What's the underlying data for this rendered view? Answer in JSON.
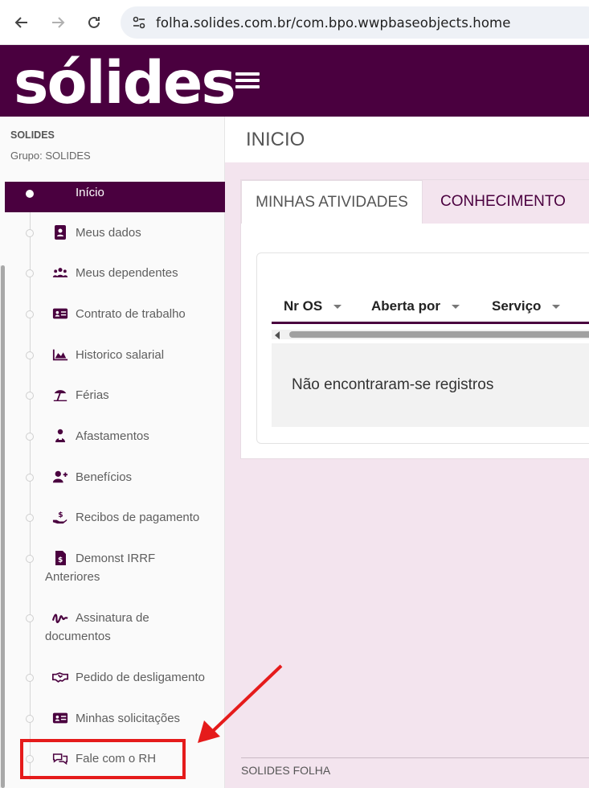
{
  "browser": {
    "url": "folha.solides.com.br/com.bpo.wwpbaseobjects.home"
  },
  "header": {
    "logo_text": "sólides"
  },
  "sidebar": {
    "company": "SOLIDES",
    "group": "Grupo: SOLIDES",
    "items": [
      {
        "label": "Início",
        "icon": "home-icon",
        "active": true
      },
      {
        "label": "Meus dados",
        "icon": "contact-book-icon"
      },
      {
        "label": "Meus dependentes",
        "icon": "people-group-icon"
      },
      {
        "label": "Contrato de trabalho",
        "icon": "id-card-icon"
      },
      {
        "label": "Historico salarial",
        "icon": "area-chart-icon"
      },
      {
        "label": "Férias",
        "icon": "beach-umbrella-icon"
      },
      {
        "label": "Afastamentos",
        "icon": "injured-person-icon"
      },
      {
        "label": "Benefícios",
        "icon": "user-plus-icon"
      },
      {
        "label": "Recibos de pagamento",
        "icon": "hand-money-icon"
      },
      {
        "label": "Demonst IRRF Anteriores",
        "icon": "tax-document-icon"
      },
      {
        "label": "Assinatura de documentos",
        "icon": "signature-icon"
      },
      {
        "label": "Pedido de desligamento",
        "icon": "handshake-icon"
      },
      {
        "label": "Minhas solicitações",
        "icon": "id-card-icon"
      },
      {
        "label": "Fale com o RH",
        "icon": "chat-bubbles-icon"
      }
    ]
  },
  "main": {
    "title": "INICIO",
    "tabs": [
      {
        "label": "MINHAS ATIVIDADES",
        "active": true
      },
      {
        "label": "CONHECIMENTO",
        "active": false
      }
    ],
    "grid": {
      "columns": [
        "Nr OS",
        "Aberta por",
        "Serviço"
      ],
      "empty_message": "Não encontraram-se registros"
    },
    "footer": "SOLIDES FOLHA"
  },
  "colors": {
    "brand": "#4a003f",
    "background": "#f3e4ee",
    "annotation": "#e51b1b"
  }
}
